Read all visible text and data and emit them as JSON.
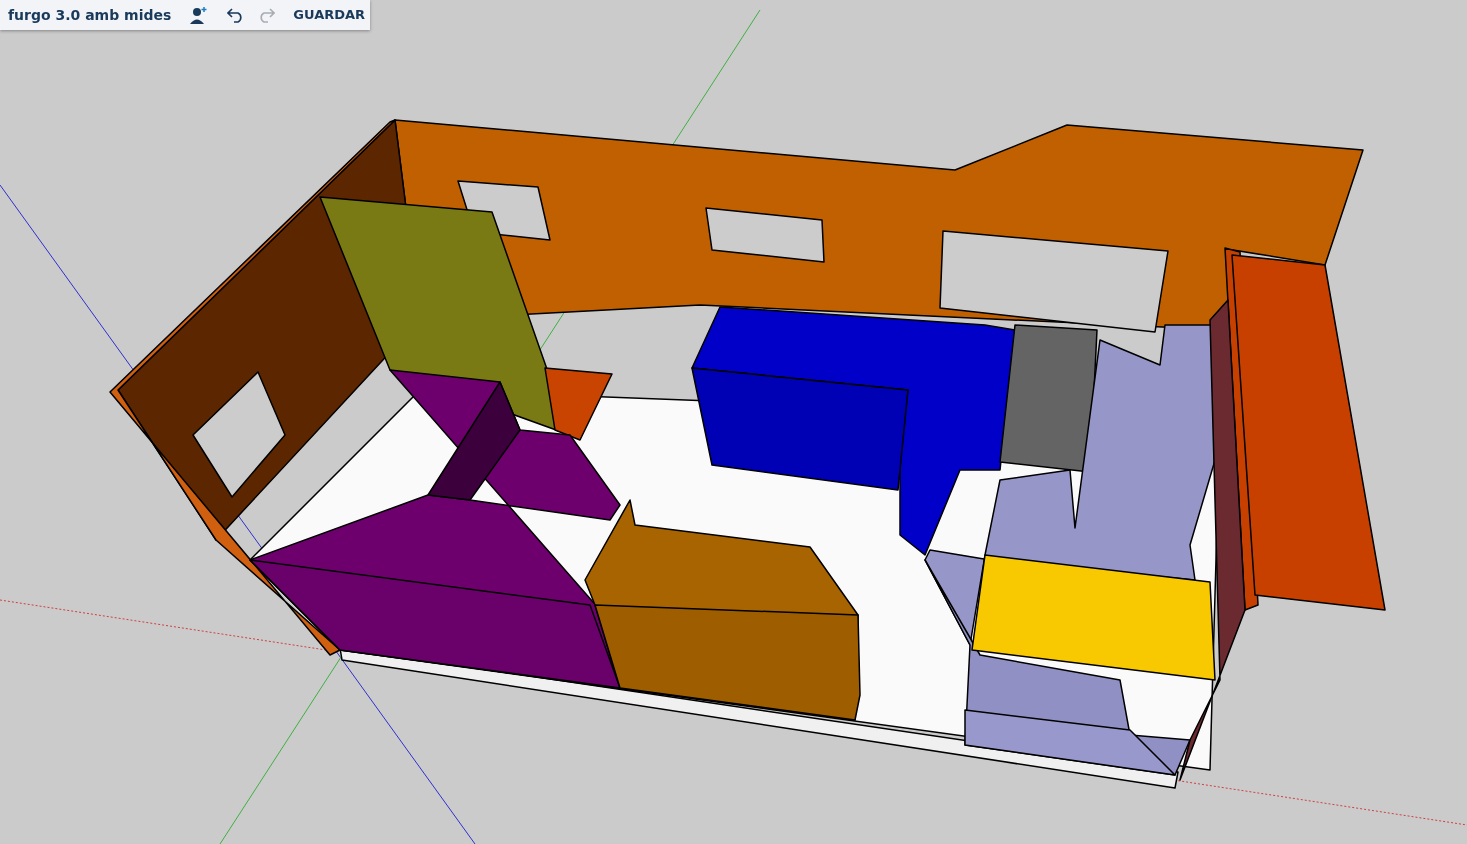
{
  "toolbar": {
    "model_title": "furgo 3.0 amb mides",
    "undo": {
      "disabled": false
    },
    "redo": {
      "disabled": true
    },
    "save_label": "GUARDAR"
  }
}
